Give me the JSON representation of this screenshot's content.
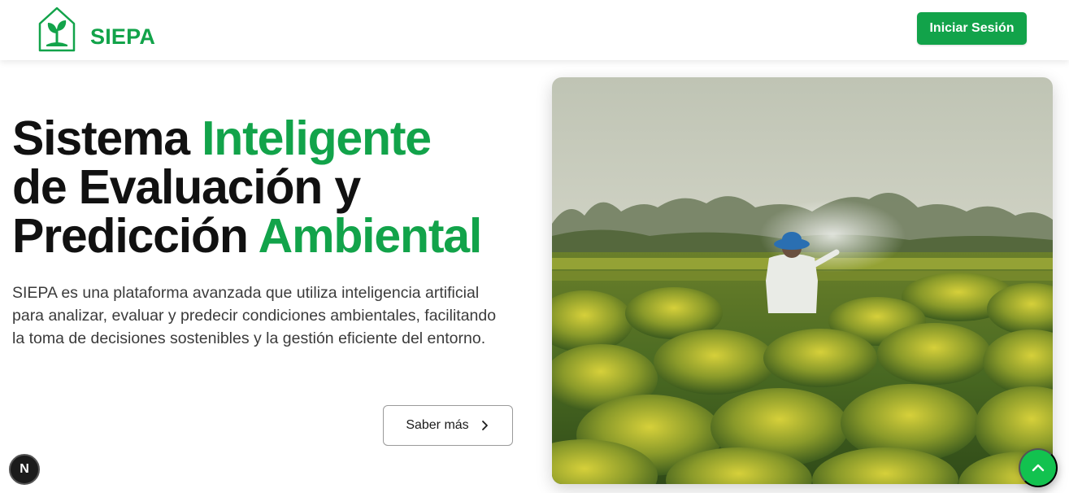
{
  "header": {
    "brand_name": "SIEPA",
    "login_label": "Iniciar Sesión"
  },
  "hero": {
    "title_part1": "Sistema ",
    "title_accent1": "Inteligente",
    "title_part2": "de Evaluación y",
    "title_part3": "Predicción ",
    "title_accent2": "Ambiental",
    "description": "SIEPA es una plataforma avanzada que utiliza inteligencia artificial para analizar, evaluar y predecir condiciones ambientales, facilitando la toma de decisiones sostenibles y la gestión eficiente del entorno.",
    "more_label": "Saber más"
  },
  "floating": {
    "n_badge": "N"
  },
  "colors": {
    "accent": "#12a34a",
    "text": "#111111",
    "scroll_top": "#12c24f"
  },
  "icons": {
    "logo": "house-sprout-icon",
    "more": "chevron-right-icon",
    "scroll_top": "chevron-up-icon"
  }
}
